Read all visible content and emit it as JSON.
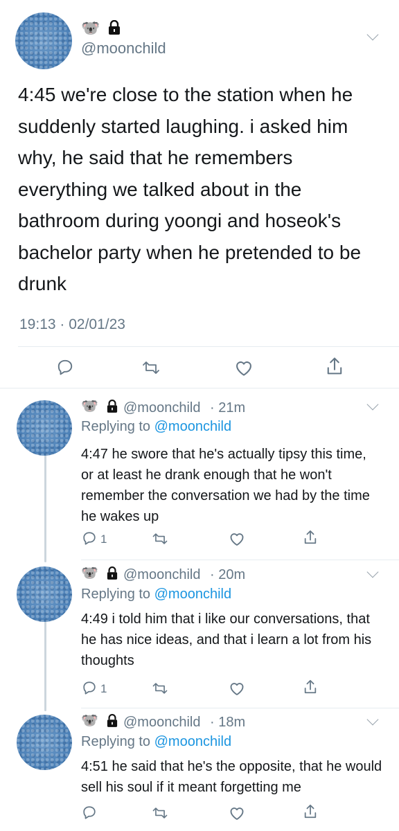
{
  "main_tweet": {
    "emoji": "🐨",
    "handle": "@moonchild",
    "text": "4:45 we're close to the station when he suddenly started laughing. i asked him why, he said that he remembers everything we talked about in the bathroom during yoongi and hoseok's bachelor party when he pretended to be drunk",
    "timestamp": "19:13 · 02/01/23"
  },
  "replies": [
    {
      "emoji": "🐨",
      "handle": "@moonchild",
      "time": "· 21m",
      "replying_prefix": "Replying to",
      "replying_to": "@moonchild",
      "text": "4:47 he swore that he's actually tipsy this time, or at least he drank enough that he won't remember the conversation we had by the time he wakes up",
      "reply_count": "1"
    },
    {
      "emoji": "🐨",
      "handle": "@moonchild",
      "time": "· 20m",
      "replying_prefix": "Replying to",
      "replying_to": "@moonchild",
      "text": "4:49 i told him that i like our conversations, that he has nice ideas, and that i learn a lot from his thoughts",
      "reply_count": "1"
    },
    {
      "emoji": "🐨",
      "handle": "@moonchild",
      "time": "· 18m",
      "replying_prefix": "Replying to",
      "replying_to": "@moonchild",
      "text": "4:51 he said that he's the opposite, that he would sell his soul if it meant forgetting me",
      "reply_count": ""
    }
  ],
  "colors": {
    "link": "#1b95e0",
    "muted": "#657786",
    "icon": "#657786"
  }
}
